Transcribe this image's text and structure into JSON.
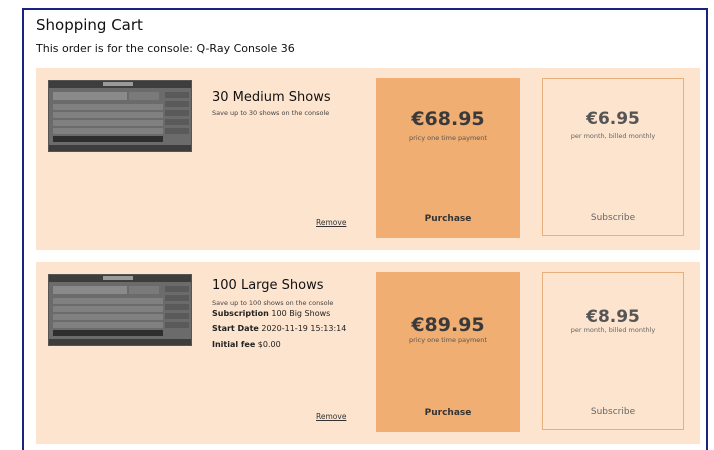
{
  "page": {
    "title": "Shopping Cart",
    "subtitle": "This order is for the console: Q-Ray Console 36"
  },
  "items": [
    {
      "name": "30 Medium Shows",
      "description": "Save up to 30 shows on the console",
      "remove_label": "Remove",
      "purchase": {
        "price": "€68.95",
        "note": "pricy one time payment",
        "label": "Purchase"
      },
      "subscribe": {
        "price": "€6.95",
        "note": "per month, billed monthly",
        "label": "Subscribe"
      }
    },
    {
      "name": "100 Large Shows",
      "description": "Save up to 100 shows on the console",
      "subscription_label": "Subscription",
      "subscription_value": "100 Big Shows",
      "start_date_label": "Start Date",
      "start_date_value": "2020-11-19 15:13:14",
      "initial_fee_label": "Initial fee",
      "initial_fee_value": "$0.00",
      "remove_label": "Remove",
      "purchase": {
        "price": "€89.95",
        "note": "pricy one time payment",
        "label": "Purchase"
      },
      "subscribe": {
        "price": "€8.95",
        "note": "per month, billed monthly",
        "label": "Subscribe"
      }
    }
  ],
  "colors": {
    "card_bg": "#fde4cf",
    "purchase_bg": "#f1ae72",
    "subscribe_border": "#e9b07e",
    "frame_border": "#1a237e"
  }
}
